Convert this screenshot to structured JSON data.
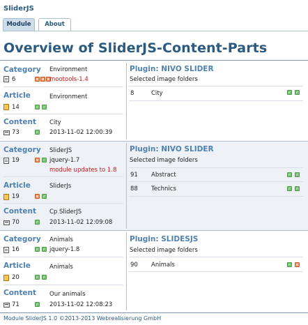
{
  "app_title": "SliderJS",
  "tabs": [
    {
      "label": "Module",
      "active": true
    },
    {
      "label": "About",
      "active": false
    }
  ],
  "page_title": "Overview of SliderJS-Content-Parts",
  "labels": {
    "category": "Category",
    "article": "Article",
    "content": "Content",
    "plugin_prefix": "Plugin:",
    "selected_folders": "Selected image folders"
  },
  "groups": [
    {
      "category": {
        "name": "Environment",
        "id": "6",
        "extra": "mootools-1.4",
        "extra_red": true
      },
      "article": {
        "name": "Environment",
        "id": "14"
      },
      "content": {
        "name": "City",
        "id": "73",
        "date": "2013-11-02 12:00:39"
      },
      "plugin": {
        "name": "NIVO SLIDER",
        "folders": [
          {
            "id": "8",
            "name": "City"
          }
        ]
      }
    },
    {
      "category": {
        "name": "SliderJS",
        "id": "19",
        "extra": "jquery-1.7",
        "note": "module updates to 1.8"
      },
      "article": {
        "name": "SliderJs",
        "id": "19"
      },
      "content": {
        "name": "Cp SliderJS",
        "id": "70",
        "date": "2013-11-02 12:09:08"
      },
      "plugin": {
        "name": "NIVO SLIDER",
        "folders": [
          {
            "id": "91",
            "name": "Abstract"
          },
          {
            "id": "88",
            "name": "Technics"
          }
        ]
      }
    },
    {
      "category": {
        "name": "Animals",
        "id": "16",
        "extra": "jquery-1.8"
      },
      "article": {
        "name": "Animals",
        "id": "20"
      },
      "content": {
        "name": "Our animals",
        "id": "71",
        "date": "2013-11-02 12:08:23"
      },
      "plugin": {
        "name": "SLIDESJS",
        "folders": [
          {
            "id": "90",
            "name": "Animals"
          }
        ]
      }
    }
  ],
  "footer": "Module SliderJS 1.0 ©2013-2013 Webrealisierung GmbH",
  "colors": {
    "heading": "#2c5a7e",
    "section_label": "#4f81b0",
    "warning": "#c01818",
    "status_green": "#7dc07a",
    "status_orange": "#f08a5a"
  }
}
